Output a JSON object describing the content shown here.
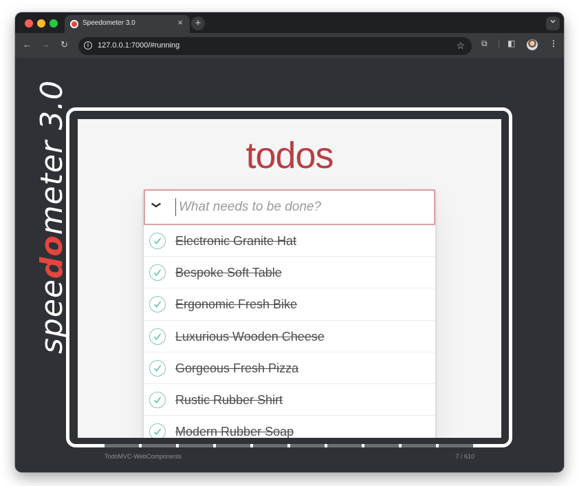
{
  "browser": {
    "tab": {
      "title": "Speedometer 3.0",
      "close": "×",
      "favicon": "speedometer-icon"
    },
    "new_tab": "+",
    "tabs_menu": "⌄",
    "nav": {
      "back": "←",
      "forward": "→",
      "reload": "↻"
    },
    "address": {
      "info": "i",
      "url": "127.0.0.1:7000/#running"
    },
    "toolbar": {
      "bookmark": "☆",
      "extensions": "⧉",
      "side_panel": "◧",
      "menu": "⋮"
    }
  },
  "benchmark": {
    "logo": {
      "part1": "spee",
      "highlight": "do",
      "part2": "meter 3.0"
    },
    "suite": "TodoMVC-WebComponents",
    "counter": "7 / 610",
    "progress_segments": 10
  },
  "todo": {
    "title": "todos",
    "toggle_all": "❯",
    "input_placeholder": "What needs to be done?",
    "items": [
      {
        "label": "Electronic Granite Hat",
        "completed": true
      },
      {
        "label": "Bespoke Soft Table",
        "completed": true
      },
      {
        "label": "Ergonomic Fresh Bike",
        "completed": true
      },
      {
        "label": "Luxurious Wooden Cheese",
        "completed": true
      },
      {
        "label": "Gorgeous Fresh Pizza",
        "completed": true
      },
      {
        "label": "Rustic Rubber Shirt",
        "completed": true
      },
      {
        "label": "Modern Rubber Soap",
        "completed": true
      }
    ]
  },
  "colors": {
    "accent": "#b83f45",
    "logo_red": "#e4463f",
    "check": "#5dc2af"
  }
}
